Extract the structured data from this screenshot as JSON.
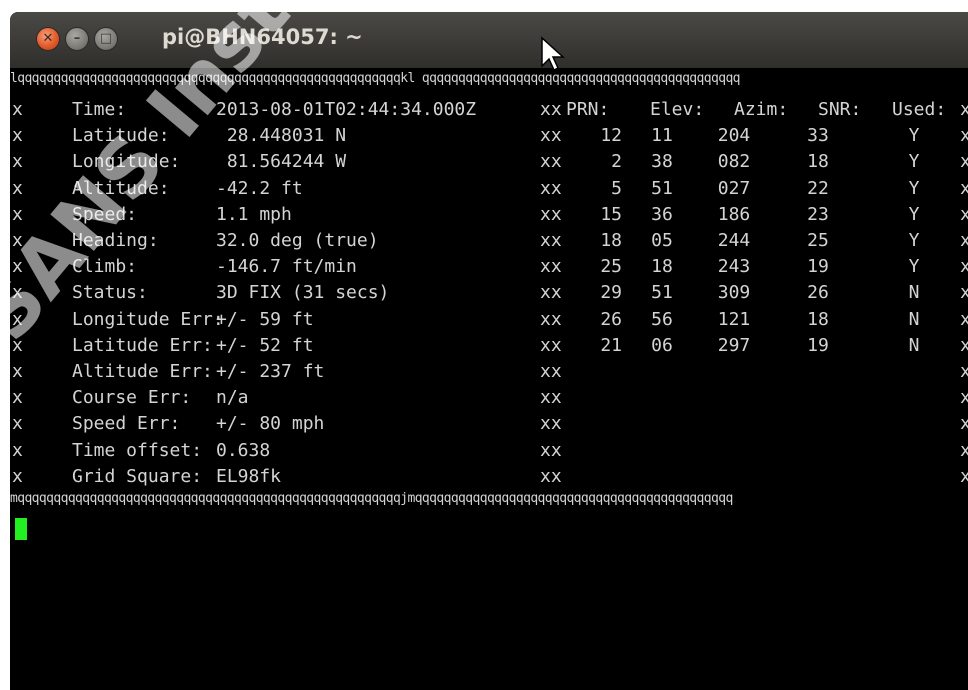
{
  "window": {
    "title": "pi@BHN64057: ~",
    "buttons": {
      "close": "✕",
      "minimize": "–",
      "maximize": "□"
    }
  },
  "terminal": {
    "top_border": "lqqqqqqqqqqqqqqqqqqqqqqqqqqqqqqqqqqqqqqqqqqqqqqqqqqqqqkl qqqqqqqqqqqqqqqqqqqqqqqqqqqqqqqqqqqqqqqqqqqq",
    "bottom_border": "mqqqqqqqqqqqqqqqqqqqqqqqqqqqqqqqqqqqqqqqqqqqqqqqqqqqqqjmqqqqqqqqqqqqqqqqqqqqqqqqqqqqqqqqqqqqqqqqqqqq",
    "side_char": "x",
    "mid_char": "xx",
    "left_rows": [
      {
        "label": "Time:",
        "value": "2013-08-01T02:44:34.000Z"
      },
      {
        "label": "Latitude:",
        "value": " 28.448031 N"
      },
      {
        "label": "Longitude:",
        "value": " 81.564244 W"
      },
      {
        "label": "Altitude:",
        "value": "-42.2 ft"
      },
      {
        "label": "Speed:",
        "value": "1.1 mph"
      },
      {
        "label": "Heading:",
        "value": "32.0 deg (true)"
      },
      {
        "label": "Climb:",
        "value": "-146.7 ft/min"
      },
      {
        "label": "Status:",
        "value": "3D FIX (31 secs)"
      },
      {
        "label": "Longitude Err:",
        "value": "+/- 59 ft"
      },
      {
        "label": "Latitude Err:",
        "value": "+/- 52 ft"
      },
      {
        "label": "Altitude Err:",
        "value": "+/- 237 ft"
      },
      {
        "label": "Course Err:",
        "value": "n/a"
      },
      {
        "label": "Speed Err:",
        "value": "+/- 80 mph"
      },
      {
        "label": "Time offset:",
        "value": "0.638"
      },
      {
        "label": "Grid Square:",
        "value": "EL98fk"
      }
    ],
    "satellite_headers": [
      "PRN:",
      "Elev:",
      "Azim:",
      "SNR:",
      "Used:"
    ],
    "satellites": [
      [
        "12",
        "11",
        "204",
        "33",
        "Y"
      ],
      [
        "2",
        "38",
        "082",
        "18",
        "Y"
      ],
      [
        "5",
        "51",
        "027",
        "22",
        "Y"
      ],
      [
        "15",
        "36",
        "186",
        "23",
        "Y"
      ],
      [
        "18",
        "05",
        "244",
        "25",
        "Y"
      ],
      [
        "25",
        "18",
        "243",
        "19",
        "Y"
      ],
      [
        "29",
        "51",
        "309",
        "26",
        "N"
      ],
      [
        "26",
        "56",
        "121",
        "18",
        "N"
      ],
      [
        "21",
        "06",
        "297",
        "19",
        "N"
      ]
    ]
  },
  "watermark": "SANS Institute, Author retains full rights",
  "colors": {
    "background": "#000000",
    "text": "#d4d4d4",
    "cursor": "#22ee22"
  }
}
